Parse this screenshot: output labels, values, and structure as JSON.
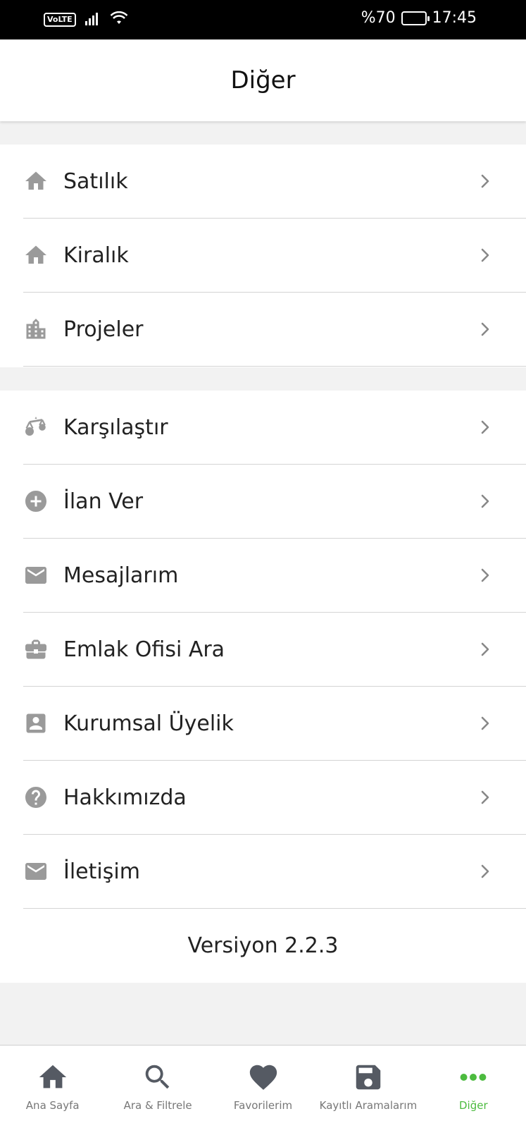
{
  "status_bar": {
    "network_badge": "VoLTE",
    "battery_percent": "%70",
    "battery_level": 0.7,
    "time": "17:45"
  },
  "header": {
    "title": "Diğer"
  },
  "menu_groups": [
    [
      {
        "icon": "home-icon",
        "label": "Satılık"
      },
      {
        "icon": "home-icon",
        "label": "Kiralık"
      },
      {
        "icon": "building-icon",
        "label": "Projeler"
      }
    ],
    [
      {
        "icon": "scale-icon",
        "label": "Karşılaştır"
      },
      {
        "icon": "add-circle-icon",
        "label": "İlan Ver"
      },
      {
        "icon": "mail-icon",
        "label": "Mesajlarım"
      },
      {
        "icon": "briefcase-icon",
        "label": "Emlak Ofisi Ara"
      },
      {
        "icon": "account-box-icon",
        "label": "Kurumsal Üyelik"
      },
      {
        "icon": "help-icon",
        "label": "Hakkımızda"
      },
      {
        "icon": "mail-icon",
        "label": "İletişim"
      }
    ]
  ],
  "version": "Versiyon 2.2.3",
  "tabbar": {
    "active": "Diğer",
    "accent_color": "#4cbb3f",
    "tabs": [
      {
        "icon": "home-icon",
        "label": "Ana Sayfa"
      },
      {
        "icon": "search-icon",
        "label": "Ara & Filtrele"
      },
      {
        "icon": "heart-icon",
        "label": "Favorilerim"
      },
      {
        "icon": "save-icon",
        "label": "Kayıtlı Aramalarım"
      },
      {
        "icon": "more-dots-icon",
        "label": "Diğer"
      }
    ]
  }
}
